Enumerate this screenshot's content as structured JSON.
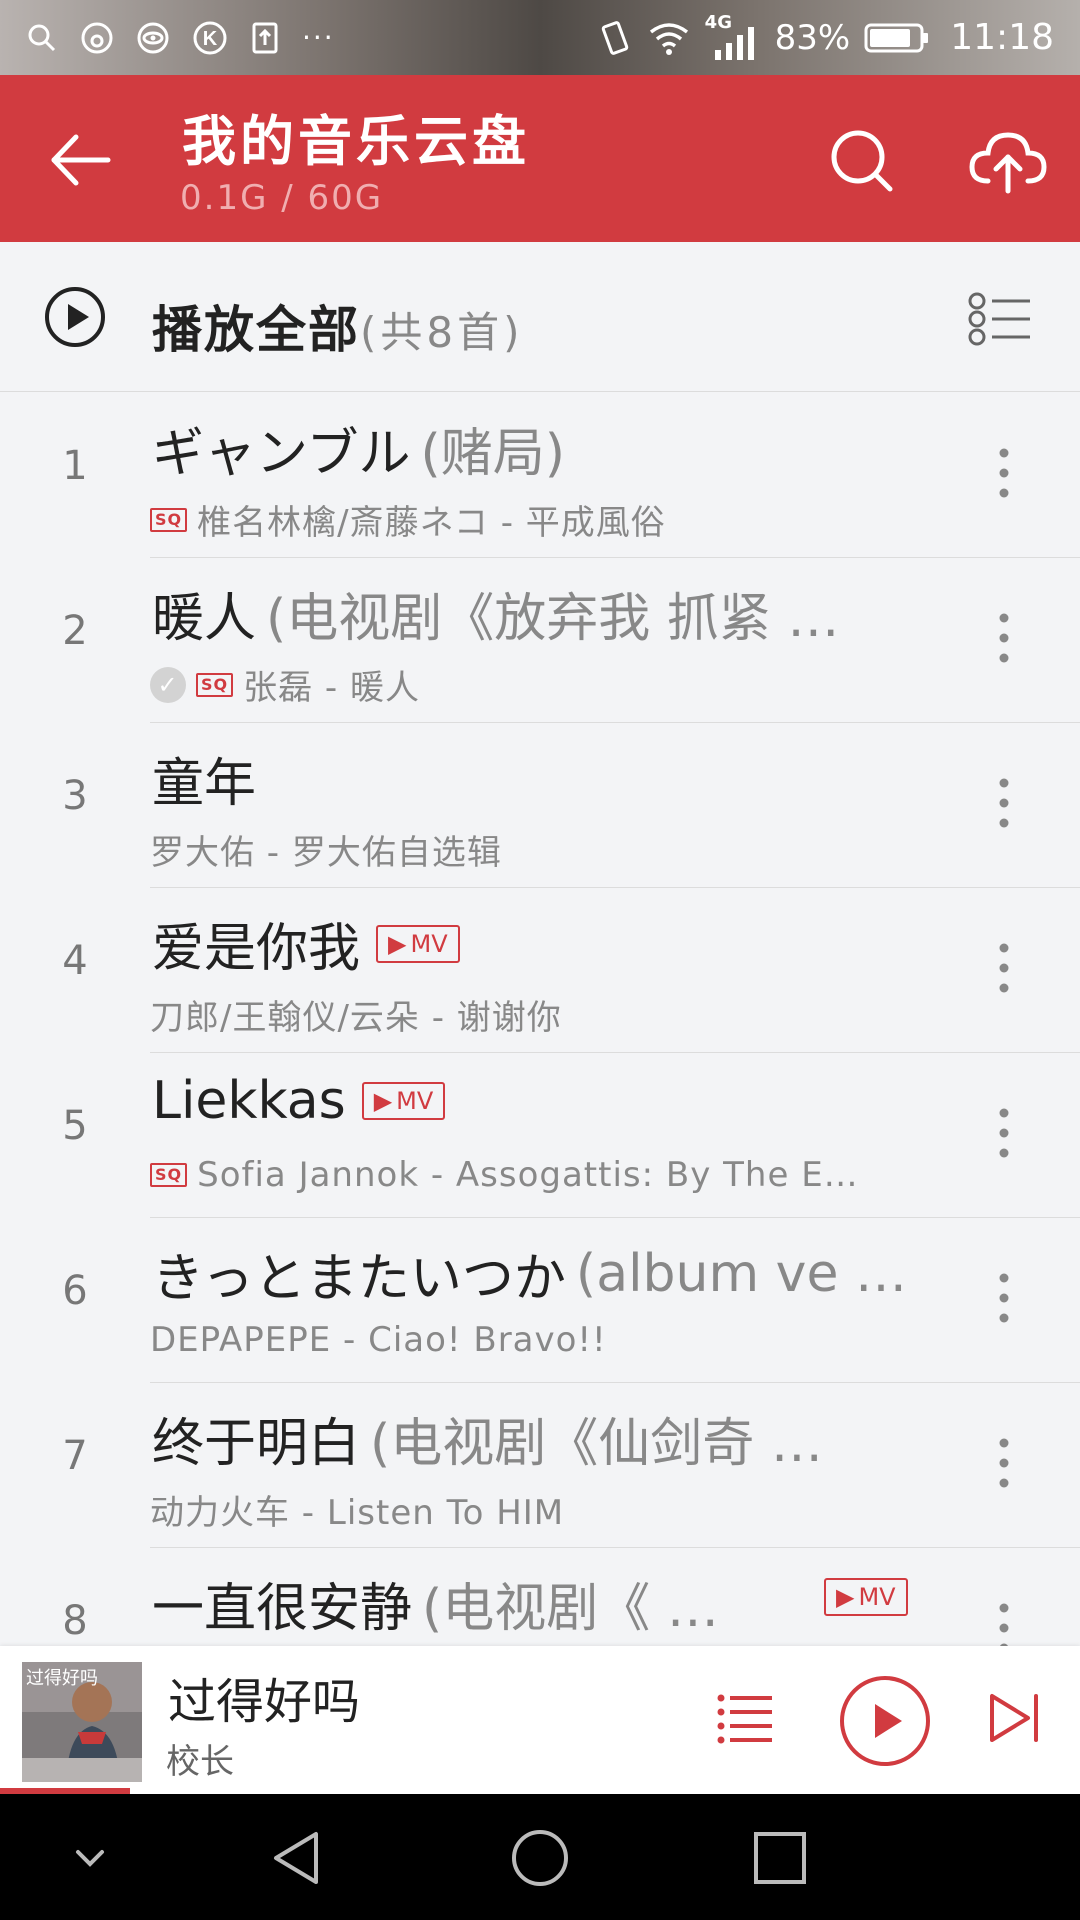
{
  "status_bar": {
    "battery": "83%",
    "time": "11:18",
    "network": "4G",
    "more": "···"
  },
  "header": {
    "title": "我的音乐云盘",
    "storage": "0.1G / 60G"
  },
  "play_all": {
    "label": "播放全部",
    "count": "(共8首)"
  },
  "songs": [
    {
      "index": "1",
      "title": "ギャンブル",
      "title_sub": "(赌局)",
      "meta": "椎名林檎/斎藤ネコ - 平成風俗",
      "sq": true,
      "mv": false,
      "downloaded": false
    },
    {
      "index": "2",
      "title": "暖人",
      "title_sub": "(电视剧《放弃我 抓紧 …",
      "meta": "张磊 - 暖人",
      "sq": true,
      "mv": false,
      "downloaded": true
    },
    {
      "index": "3",
      "title": "童年",
      "title_sub": "",
      "meta": "罗大佑 - 罗大佑自选辑",
      "sq": false,
      "mv": false,
      "downloaded": false
    },
    {
      "index": "4",
      "title": "爱是你我",
      "title_sub": "",
      "meta": "刀郎/王翰仪/云朵 - 谢谢你",
      "sq": false,
      "mv": true,
      "downloaded": false
    },
    {
      "index": "5",
      "title": "Liekkas",
      "title_sub": "",
      "meta": "Sofia Jannok - Assogattis: By The E…",
      "sq": true,
      "mv": true,
      "downloaded": false
    },
    {
      "index": "6",
      "title": "きっとまたいつか",
      "title_sub": "(album ve …",
      "meta": "DEPAPEPE - Ciao! Bravo!!",
      "sq": false,
      "mv": false,
      "downloaded": false
    },
    {
      "index": "7",
      "title": "终于明白",
      "title_sub": "(电视剧《仙剑奇 …",
      "meta": "动力火车 - Listen To HIM",
      "sq": false,
      "mv": false,
      "downloaded": false
    },
    {
      "index": "8",
      "title": "一直很安静",
      "title_sub": "(电视剧《 …",
      "meta": "",
      "sq": false,
      "mv": true,
      "downloaded": false
    }
  ],
  "badges": {
    "sq": "SQ",
    "mv": "MV",
    "mv_icon": "▶"
  },
  "now_playing": {
    "title": "过得好吗",
    "artist": "校长",
    "art_caption": "过得好吗",
    "progress": 0.12
  },
  "colors": {
    "accent": "#d13b40",
    "background": "#f3f4f6"
  },
  "icons": [
    "search-icon",
    "upload-cloud-icon",
    "back-arrow-icon",
    "play-circle-icon",
    "multi-select-icon",
    "more-vertical-icon",
    "playlist-icon",
    "next-icon",
    "nav-back-icon",
    "nav-home-icon",
    "nav-recent-icon"
  ]
}
